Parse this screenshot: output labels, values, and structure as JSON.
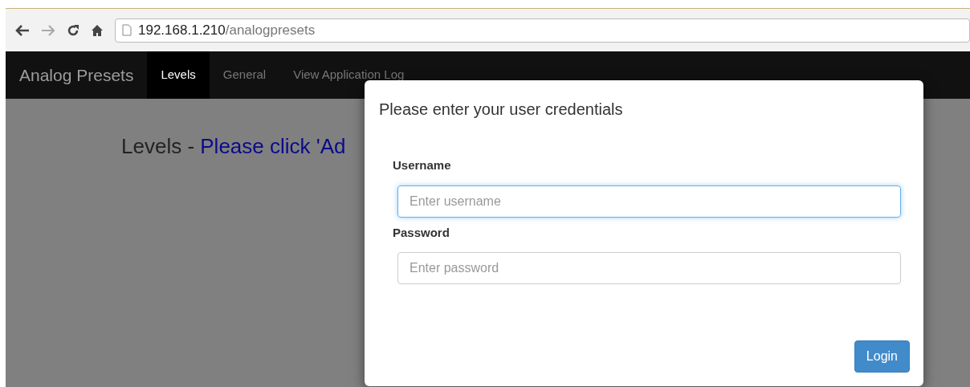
{
  "browser": {
    "url_host": "192.168.1.210",
    "url_path": "/analogpresets"
  },
  "navbar": {
    "brand": "Analog Presets",
    "items": [
      {
        "label": "Levels",
        "selected": true
      },
      {
        "label": "General",
        "selected": false
      },
      {
        "label": "View Application Log",
        "selected": false
      }
    ]
  },
  "heading": {
    "prefix": "Levels - ",
    "message": "Please click 'Ad"
  },
  "modal": {
    "title": "Please enter your user credentials",
    "fields": [
      {
        "label": "Username",
        "placeholder": "Enter username",
        "focused": true
      },
      {
        "label": "Password",
        "placeholder": "Enter password",
        "focused": false
      }
    ],
    "button": "Login"
  }
}
